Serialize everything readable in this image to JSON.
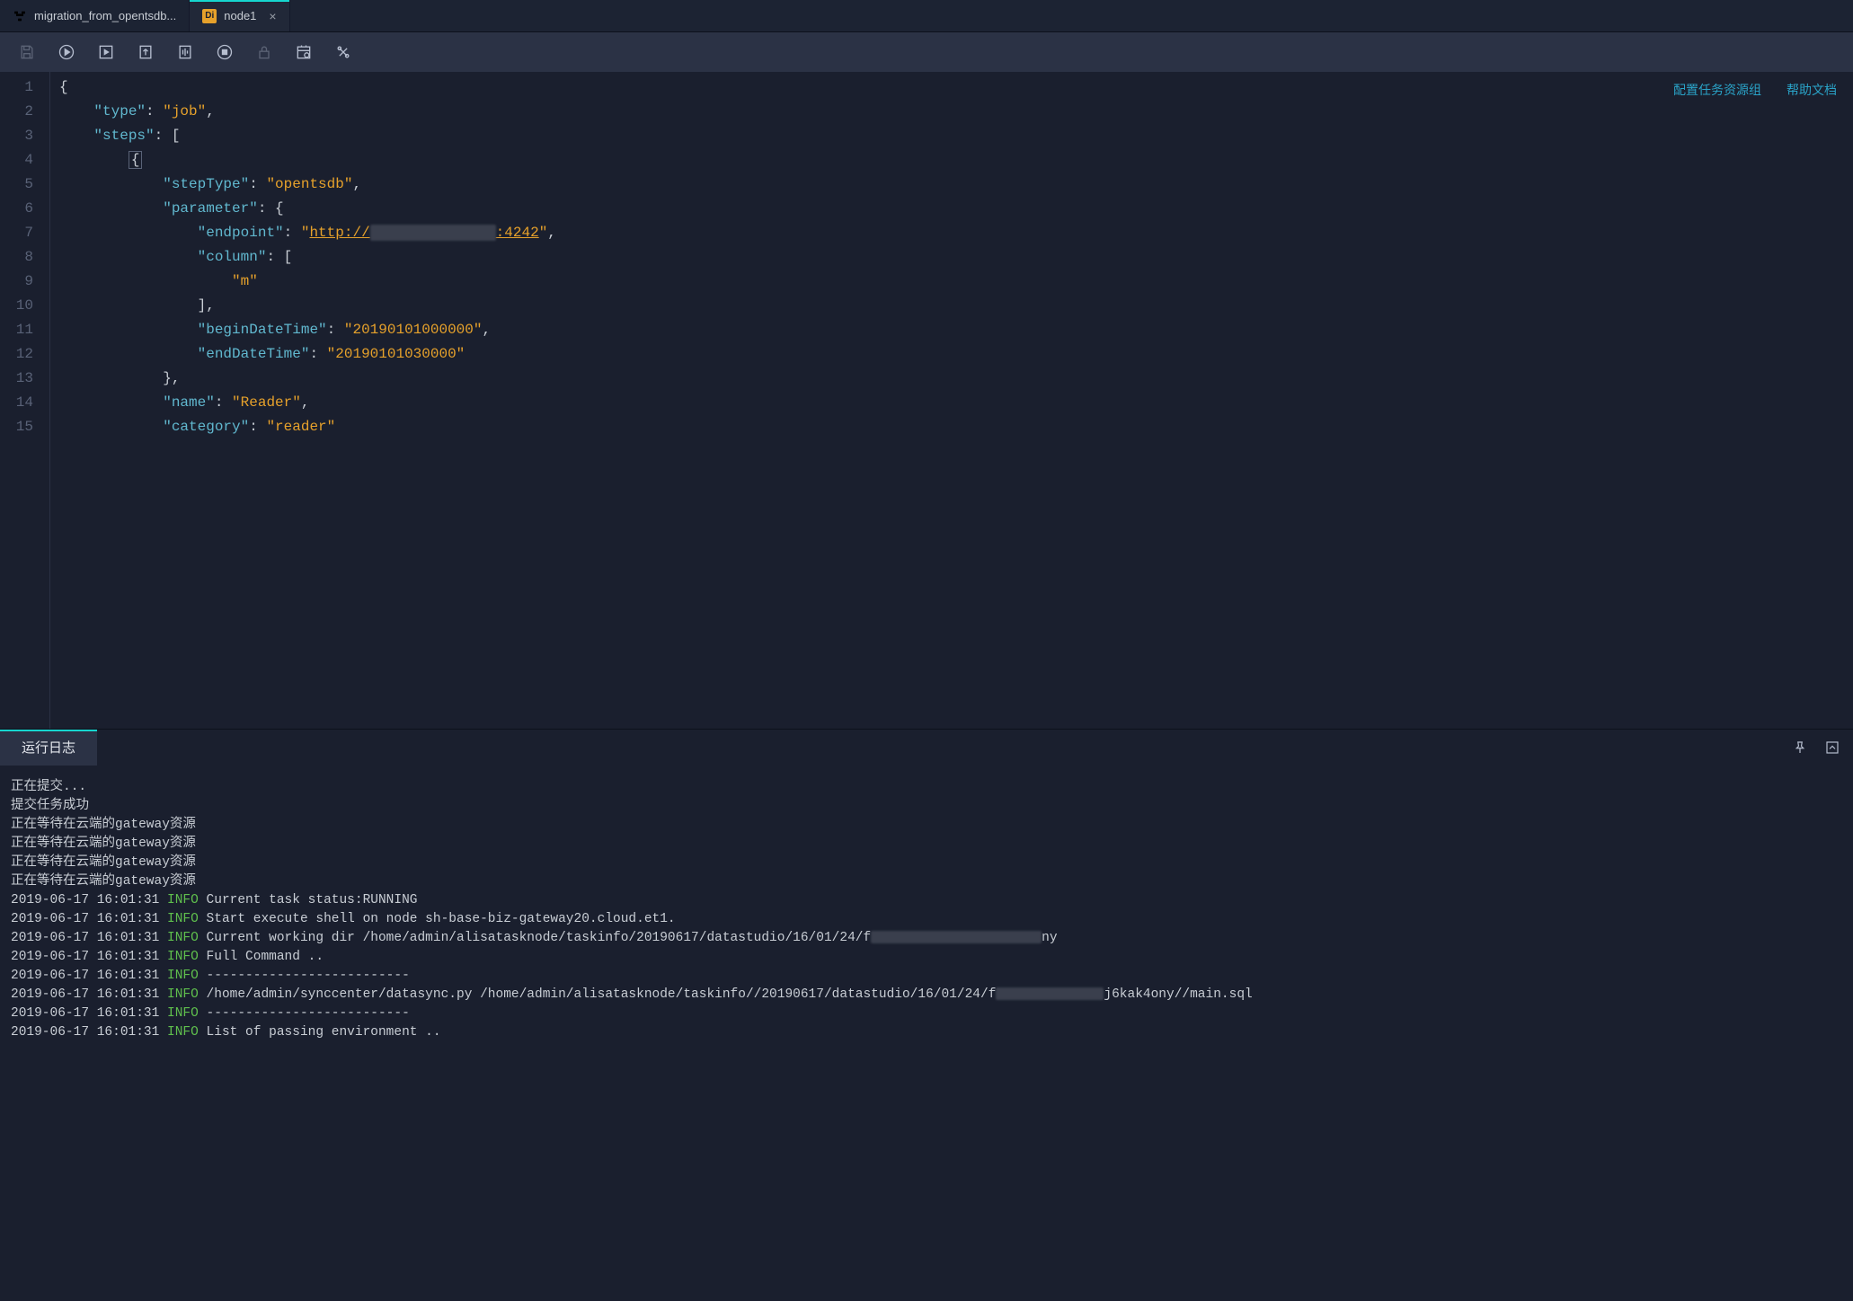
{
  "tabs": [
    {
      "label": "migration_from_opentsdb...",
      "icon": "flow-icon",
      "active": false,
      "closable": false
    },
    {
      "label": "node1",
      "icon": "di-badge",
      "active": true,
      "closable": true
    }
  ],
  "toolbar": {
    "buttons": [
      {
        "name": "save-icon",
        "disabled": true
      },
      {
        "name": "run-icon",
        "disabled": false
      },
      {
        "name": "run-selection-icon",
        "disabled": false
      },
      {
        "name": "submit-icon",
        "disabled": false
      },
      {
        "name": "format-icon",
        "disabled": false
      },
      {
        "name": "stop-icon",
        "disabled": false
      },
      {
        "name": "lock-icon",
        "disabled": true
      },
      {
        "name": "schedule-icon",
        "disabled": false
      },
      {
        "name": "tools-icon",
        "disabled": false
      }
    ]
  },
  "editorLinks": {
    "resource": "配置任务资源组",
    "help": "帮助文档"
  },
  "code": {
    "lineStart": 1,
    "lines": [
      [
        {
          "t": "punc",
          "v": "{"
        }
      ],
      [
        {
          "t": "pad",
          "v": "    "
        },
        {
          "t": "key",
          "v": "\"type\""
        },
        {
          "t": "punc",
          "v": ": "
        },
        {
          "t": "str",
          "v": "\"job\""
        },
        {
          "t": "punc",
          "v": ","
        }
      ],
      [
        {
          "t": "pad",
          "v": "    "
        },
        {
          "t": "key",
          "v": "\"steps\""
        },
        {
          "t": "punc",
          "v": ": ["
        }
      ],
      [
        {
          "t": "pad",
          "v": "        "
        },
        {
          "t": "fold",
          "v": "{"
        }
      ],
      [
        {
          "t": "pad",
          "v": "            "
        },
        {
          "t": "key",
          "v": "\"stepType\""
        },
        {
          "t": "punc",
          "v": ": "
        },
        {
          "t": "str",
          "v": "\"opentsdb\""
        },
        {
          "t": "punc",
          "v": ","
        }
      ],
      [
        {
          "t": "pad",
          "v": "            "
        },
        {
          "t": "key",
          "v": "\"parameter\""
        },
        {
          "t": "punc",
          "v": ": {"
        }
      ],
      [
        {
          "t": "pad",
          "v": "                "
        },
        {
          "t": "key",
          "v": "\"endpoint\""
        },
        {
          "t": "punc",
          "v": ": "
        },
        {
          "t": "str",
          "v": "\""
        },
        {
          "t": "url",
          "v": "http://"
        },
        {
          "t": "redact",
          "v": ""
        },
        {
          "t": "url",
          "v": ":4242"
        },
        {
          "t": "str",
          "v": "\""
        },
        {
          "t": "punc",
          "v": ","
        }
      ],
      [
        {
          "t": "pad",
          "v": "                "
        },
        {
          "t": "key",
          "v": "\"column\""
        },
        {
          "t": "punc",
          "v": ": ["
        }
      ],
      [
        {
          "t": "pad",
          "v": "                    "
        },
        {
          "t": "str",
          "v": "\"m\""
        }
      ],
      [
        {
          "t": "pad",
          "v": "                "
        },
        {
          "t": "punc",
          "v": "],"
        }
      ],
      [
        {
          "t": "pad",
          "v": "                "
        },
        {
          "t": "key",
          "v": "\"beginDateTime\""
        },
        {
          "t": "punc",
          "v": ": "
        },
        {
          "t": "str",
          "v": "\"20190101000000\""
        },
        {
          "t": "punc",
          "v": ","
        }
      ],
      [
        {
          "t": "pad",
          "v": "                "
        },
        {
          "t": "key",
          "v": "\"endDateTime\""
        },
        {
          "t": "punc",
          "v": ": "
        },
        {
          "t": "str",
          "v": "\"20190101030000\""
        }
      ],
      [
        {
          "t": "pad",
          "v": "            "
        },
        {
          "t": "punc",
          "v": "},"
        }
      ],
      [
        {
          "t": "pad",
          "v": "            "
        },
        {
          "t": "key",
          "v": "\"name\""
        },
        {
          "t": "punc",
          "v": ": "
        },
        {
          "t": "str",
          "v": "\"Reader\""
        },
        {
          "t": "punc",
          "v": ","
        }
      ],
      [
        {
          "t": "pad",
          "v": "            "
        },
        {
          "t": "key",
          "v": "\"category\""
        },
        {
          "t": "punc",
          "v": ": "
        },
        {
          "t": "str",
          "v": "\"reader\""
        }
      ]
    ]
  },
  "logPanel": {
    "tabLabel": "运行日志",
    "plainLines": [
      "正在提交...",
      "提交任务成功",
      "正在等待在云端的gateway资源",
      "正在等待在云端的gateway资源",
      "正在等待在云端的gateway资源",
      "正在等待在云端的gateway资源"
    ],
    "entries": [
      {
        "ts": "2019-06-17 16:01:31",
        "level": "INFO",
        "msg": "Current task status:RUNNING"
      },
      {
        "ts": "2019-06-17 16:01:31",
        "level": "INFO",
        "msg": "Start execute shell on node sh-base-biz-gateway20.cloud.et1."
      },
      {
        "ts": "2019-06-17 16:01:31",
        "level": "INFO",
        "msg": "Current working dir /home/admin/alisatasknode/taskinfo/20190617/datastudio/16/01/24/f",
        "redactWidth": 190,
        "suffix": "ny"
      },
      {
        "ts": "2019-06-17 16:01:31",
        "level": "INFO",
        "msg": "Full Command .."
      },
      {
        "ts": "2019-06-17 16:01:31",
        "level": "INFO",
        "msg": "--------------------------"
      },
      {
        "ts": "2019-06-17 16:01:31",
        "level": "INFO",
        "msg": "/home/admin/synccenter/datasync.py /home/admin/alisatasknode/taskinfo//20190617/datastudio/16/01/24/f",
        "redactWidth": 120,
        "suffix": "j6kak4ony//main.sql"
      },
      {
        "ts": "2019-06-17 16:01:31",
        "level": "INFO",
        "msg": "--------------------------"
      },
      {
        "ts": "2019-06-17 16:01:31",
        "level": "INFO",
        "msg": "List of passing environment .."
      }
    ]
  }
}
